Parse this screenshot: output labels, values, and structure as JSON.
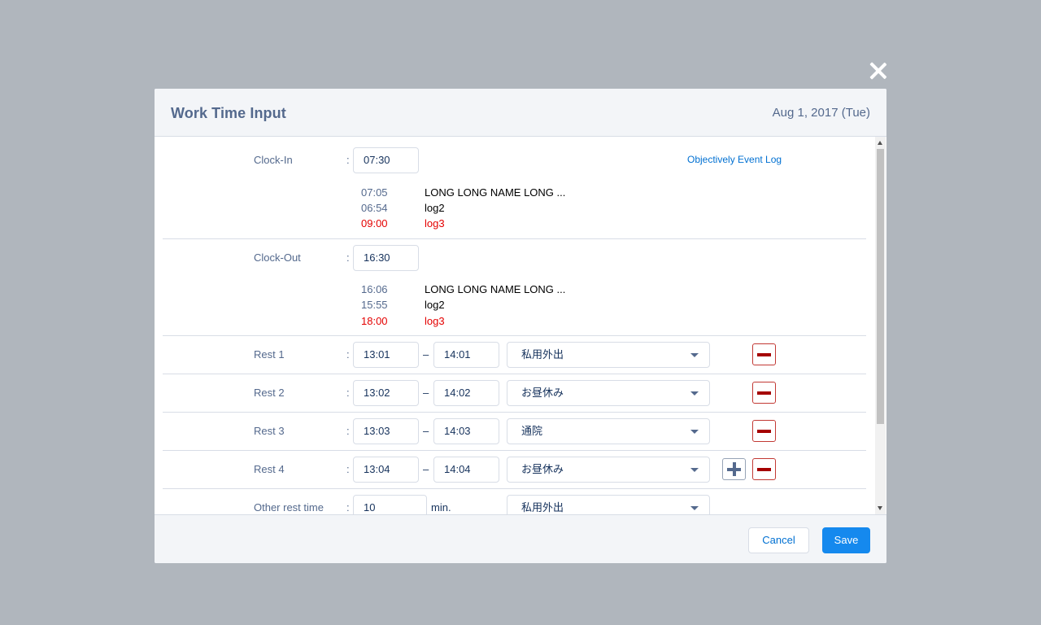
{
  "modal": {
    "title": "Work Time Input",
    "date": "Aug 1, 2017 (Tue)"
  },
  "clock_in": {
    "label": "Clock-In",
    "value": "07:30",
    "link": "Objectively Event Log",
    "logs": [
      {
        "time": "07:05",
        "name": "LONG LONG NAME LONG ...",
        "highlight": false
      },
      {
        "time": "06:54",
        "name": "log2",
        "highlight": false
      },
      {
        "time": "09:00",
        "name": "log3",
        "highlight": true
      }
    ]
  },
  "clock_out": {
    "label": "Clock-Out",
    "value": "16:30",
    "logs": [
      {
        "time": "16:06",
        "name": "LONG LONG NAME LONG ...",
        "highlight": false
      },
      {
        "time": "15:55",
        "name": "log2",
        "highlight": false
      },
      {
        "time": "18:00",
        "name": "log3",
        "highlight": true
      }
    ]
  },
  "colon": ":",
  "dash": "–",
  "rests": [
    {
      "label": "Rest 1",
      "start": "13:01",
      "end": "14:01",
      "reason": "私用外出"
    },
    {
      "label": "Rest 2",
      "start": "13:02",
      "end": "14:02",
      "reason": "お昼休み"
    },
    {
      "label": "Rest 3",
      "start": "13:03",
      "end": "14:03",
      "reason": "通院"
    },
    {
      "label": "Rest 4",
      "start": "13:04",
      "end": "14:04",
      "reason": "お昼休み"
    }
  ],
  "other_rest": {
    "label": "Other rest time",
    "value": "10",
    "unit": "min.",
    "reason": "私用外出"
  },
  "footer": {
    "cancel_label": "Cancel",
    "save_label": "Save"
  },
  "colors": {
    "accent": "#1589ee",
    "remove": "#a50000",
    "log_highlight": "#e40000",
    "label": "#54698d"
  },
  "icons": {
    "close": "close-icon",
    "remove": "minus-icon",
    "add": "plus-icon",
    "dropdown": "chevron-down-icon"
  }
}
